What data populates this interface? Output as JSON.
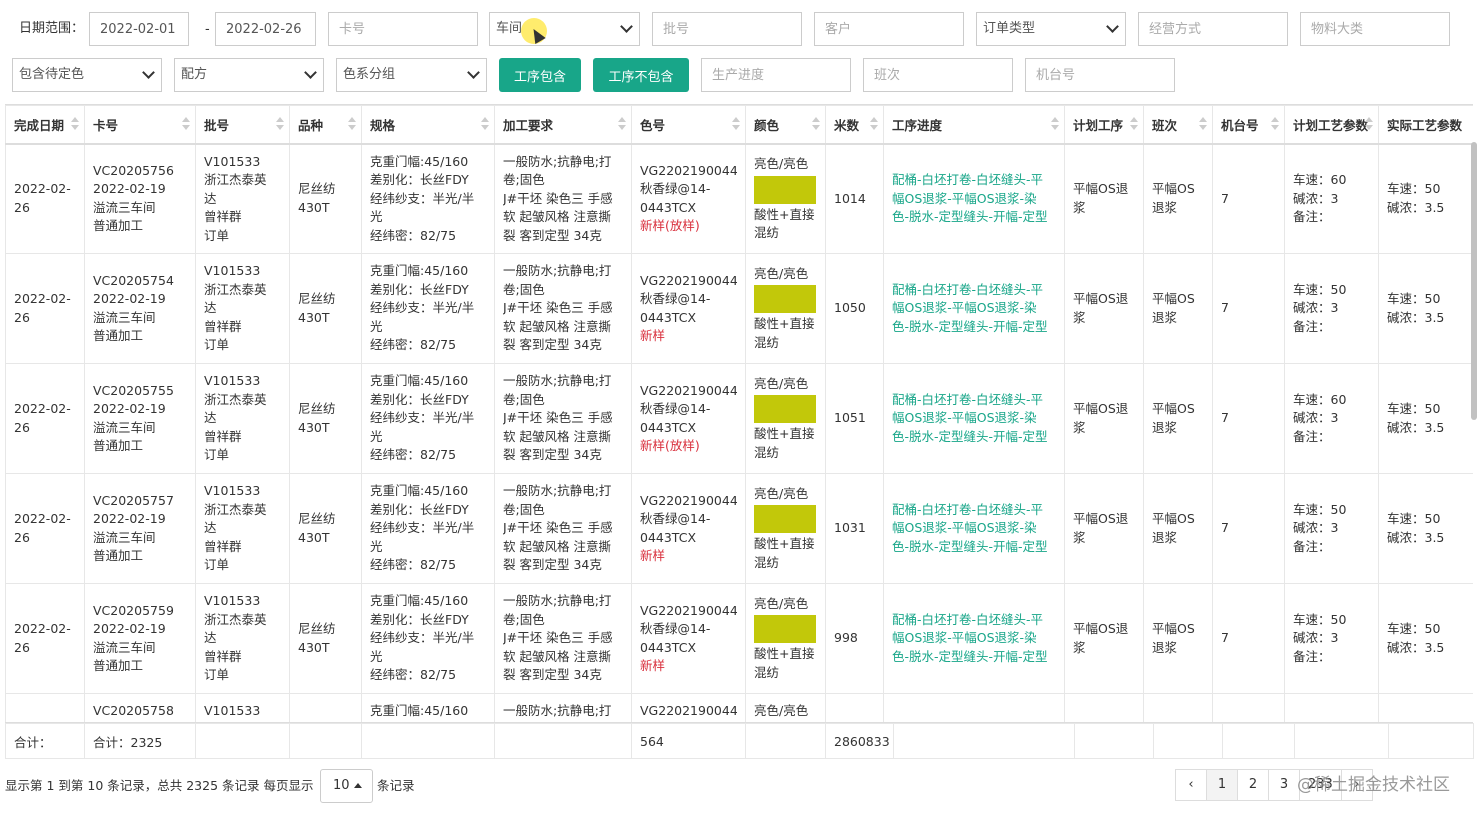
{
  "filters": {
    "date_range_label": "日期范围：",
    "date_from": "2022-02-01",
    "date_sep": "-",
    "date_to": "2022-02-26",
    "card_no_placeholder": "卡号",
    "workshop_value": "车间",
    "batch_no_placeholder": "批号",
    "customer_placeholder": "客户",
    "order_type_value": "订单类型",
    "business_mode_placeholder": "经营方式",
    "material_category_placeholder": "物料大类",
    "pending_color_value": "包含待定色",
    "recipe_value": "配方",
    "color_group_value": "色系分组",
    "process_include_label": "工序包含",
    "process_exclude_label": "工序不包含",
    "production_progress_placeholder": "生产进度",
    "shift_placeholder": "班次",
    "machine_no_placeholder": "机台号"
  },
  "table": {
    "columns": [
      "完成日期",
      "卡号",
      "批号",
      "品种",
      "规格",
      "加工要求",
      "色号",
      "颜色",
      "米数",
      "工序进度",
      "计划工序",
      "班次",
      "机台号",
      "计划工艺参数",
      "实际工艺参数"
    ],
    "rows": [
      {
        "date": [
          "2022-02-",
          "26"
        ],
        "card": [
          "VC20205756",
          "2022-02-19",
          "溢流三车间",
          "普通加工"
        ],
        "batch": [
          "V101533",
          "浙江杰泰英",
          "达",
          "曾祥群",
          "订单"
        ],
        "variety": [
          "尼丝纺",
          "430T"
        ],
        "spec": [
          "克重门幅:45/160",
          "差别化：长丝FDY",
          "经纬纱支：半光/半",
          "光",
          "经纬密：82/75"
        ],
        "requirement": [
          "一般防水;抗静电;打",
          "卷;固色",
          "J#干坯 染色三 手感",
          "软 起皱风格 注意撕",
          "裂 客到定型 34克"
        ],
        "color_no": [
          "VG2202190044",
          "秋香绿@14-",
          "0443TCX"
        ],
        "color_tag": "新样(放样)",
        "color": [
          "亮色/亮色",
          "酸性+直接",
          "混纺"
        ],
        "meters": "1014",
        "progress": [
          "配桶-白坯打卷-白坯缝头-平",
          "幅OS退浆-平幅OS退浆-染",
          "色-脱水-定型缝头-开幅-定型"
        ],
        "plan_process": [
          "平幅OS退",
          "浆"
        ],
        "shift": [
          "平幅OS",
          "退浆"
        ],
        "machine": "7",
        "plan_params": [
          "车速：60",
          "碱浓：3",
          "备注："
        ],
        "actual_params": [
          "车速：50",
          "碱浓：3.5"
        ]
      },
      {
        "date": [
          "2022-02-",
          "26"
        ],
        "card": [
          "VC20205754",
          "2022-02-19",
          "溢流三车间",
          "普通加工"
        ],
        "batch": [
          "V101533",
          "浙江杰泰英",
          "达",
          "曾祥群",
          "订单"
        ],
        "variety": [
          "尼丝纺",
          "430T"
        ],
        "spec": [
          "克重门幅:45/160",
          "差别化：长丝FDY",
          "经纬纱支：半光/半",
          "光",
          "经纬密：82/75"
        ],
        "requirement": [
          "一般防水;抗静电;打",
          "卷;固色",
          "J#干坯 染色三 手感",
          "软 起皱风格 注意撕",
          "裂 客到定型 34克"
        ],
        "color_no": [
          "VG2202190044",
          "秋香绿@14-",
          "0443TCX"
        ],
        "color_tag": "新样",
        "color": [
          "亮色/亮色",
          "酸性+直接",
          "混纺"
        ],
        "meters": "1050",
        "progress": [
          "配桶-白坯打卷-白坯缝头-平",
          "幅OS退浆-平幅OS退浆-染",
          "色-脱水-定型缝头-开幅-定型"
        ],
        "plan_process": [
          "平幅OS退",
          "浆"
        ],
        "shift": [
          "平幅OS",
          "退浆"
        ],
        "machine": "7",
        "plan_params": [
          "车速：50",
          "碱浓：3",
          "备注："
        ],
        "actual_params": [
          "车速：50",
          "碱浓：3.5"
        ]
      },
      {
        "date": [
          "2022-02-",
          "26"
        ],
        "card": [
          "VC20205755",
          "2022-02-19",
          "溢流三车间",
          "普通加工"
        ],
        "batch": [
          "V101533",
          "浙江杰泰英",
          "达",
          "曾祥群",
          "订单"
        ],
        "variety": [
          "尼丝纺",
          "430T"
        ],
        "spec": [
          "克重门幅:45/160",
          "差别化：长丝FDY",
          "经纬纱支：半光/半",
          "光",
          "经纬密：82/75"
        ],
        "requirement": [
          "一般防水;抗静电;打",
          "卷;固色",
          "J#干坯 染色三 手感",
          "软 起皱风格 注意撕",
          "裂 客到定型 34克"
        ],
        "color_no": [
          "VG2202190044",
          "秋香绿@14-",
          "0443TCX"
        ],
        "color_tag": "新样(放样)",
        "color": [
          "亮色/亮色",
          "酸性+直接",
          "混纺"
        ],
        "meters": "1051",
        "progress": [
          "配桶-白坯打卷-白坯缝头-平",
          "幅OS退浆-平幅OS退浆-染",
          "色-脱水-定型缝头-开幅-定型"
        ],
        "plan_process": [
          "平幅OS退",
          "浆"
        ],
        "shift": [
          "平幅OS",
          "退浆"
        ],
        "machine": "7",
        "plan_params": [
          "车速：60",
          "碱浓：3",
          "备注："
        ],
        "actual_params": [
          "车速：50",
          "碱浓：3.5"
        ]
      },
      {
        "date": [
          "2022-02-",
          "26"
        ],
        "card": [
          "VC20205757",
          "2022-02-19",
          "溢流三车间",
          "普通加工"
        ],
        "batch": [
          "V101533",
          "浙江杰泰英",
          "达",
          "曾祥群",
          "订单"
        ],
        "variety": [
          "尼丝纺",
          "430T"
        ],
        "spec": [
          "克重门幅:45/160",
          "差别化：长丝FDY",
          "经纬纱支：半光/半",
          "光",
          "经纬密：82/75"
        ],
        "requirement": [
          "一般防水;抗静电;打",
          "卷;固色",
          "J#干坯 染色三 手感",
          "软 起皱风格 注意撕",
          "裂 客到定型 34克"
        ],
        "color_no": [
          "VG2202190044",
          "秋香绿@14-",
          "0443TCX"
        ],
        "color_tag": "新样",
        "color": [
          "亮色/亮色",
          "酸性+直接",
          "混纺"
        ],
        "meters": "1031",
        "progress": [
          "配桶-白坯打卷-白坯缝头-平",
          "幅OS退浆-平幅OS退浆-染",
          "色-脱水-定型缝头-开幅-定型"
        ],
        "plan_process": [
          "平幅OS退",
          "浆"
        ],
        "shift": [
          "平幅OS",
          "退浆"
        ],
        "machine": "7",
        "plan_params": [
          "车速：50",
          "碱浓：3",
          "备注："
        ],
        "actual_params": [
          "车速：50",
          "碱浓：3.5"
        ]
      },
      {
        "date": [
          "2022-02-",
          "26"
        ],
        "card": [
          "VC20205759",
          "2022-02-19",
          "溢流三车间",
          "普通加工"
        ],
        "batch": [
          "V101533",
          "浙江杰泰英",
          "达",
          "曾祥群",
          "订单"
        ],
        "variety": [
          "尼丝纺",
          "430T"
        ],
        "spec": [
          "克重门幅:45/160",
          "差别化：长丝FDY",
          "经纬纱支：半光/半",
          "光",
          "经纬密：82/75"
        ],
        "requirement": [
          "一般防水;抗静电;打",
          "卷;固色",
          "J#干坯 染色三 手感",
          "软 起皱风格 注意撕",
          "裂 客到定型 34克"
        ],
        "color_no": [
          "VG2202190044",
          "秋香绿@14-",
          "0443TCX"
        ],
        "color_tag": "新样",
        "color": [
          "亮色/亮色",
          "酸性+直接",
          "混纺"
        ],
        "meters": "998",
        "progress": [
          "配桶-白坯打卷-白坯缝头-平",
          "幅OS退浆-平幅OS退浆-染",
          "色-脱水-定型缝头-开幅-定型"
        ],
        "plan_process": [
          "平幅OS退",
          "浆"
        ],
        "shift": [
          "平幅OS",
          "退浆"
        ],
        "machine": "7",
        "plan_params": [
          "车速：50",
          "碱浓：3",
          "备注："
        ],
        "actual_params": [
          "车速：50",
          "碱浓：3.5"
        ]
      },
      {
        "date": [
          ""
        ],
        "card": [
          "VC20205758"
        ],
        "batch": [
          "V101533"
        ],
        "variety": [
          ""
        ],
        "spec": [
          "克重门幅:45/160"
        ],
        "requirement": [
          "一般防水;抗静电;打"
        ],
        "color_no": [
          "VG2202190044"
        ],
        "color_tag": "",
        "color": [
          "亮色/亮色"
        ],
        "meters": "",
        "progress": [
          ""
        ],
        "plan_process": [
          ""
        ],
        "shift": [
          ""
        ],
        "machine": "",
        "plan_params": [
          ""
        ],
        "actual_params": [
          ""
        ]
      }
    ],
    "swatch_color": "#c2c80a",
    "progress_color": "#18a689",
    "tag_color": "#d9303d"
  },
  "summary": {
    "label": "合计：",
    "card_total": "合计：2325",
    "color_no_total": "564",
    "meters_total": "2860833"
  },
  "pagination": {
    "info": "显示第 1 到第 10 条记录，总共 2325 条记录 每页显示",
    "page_size": "10",
    "records_suffix": "条记录",
    "prev": "‹",
    "pages": [
      "1",
      "2",
      "3"
    ],
    "last_page": "233",
    "next": "›",
    "watermark": "@稀土掘金技术社区"
  },
  "accent_color": "#18a689"
}
